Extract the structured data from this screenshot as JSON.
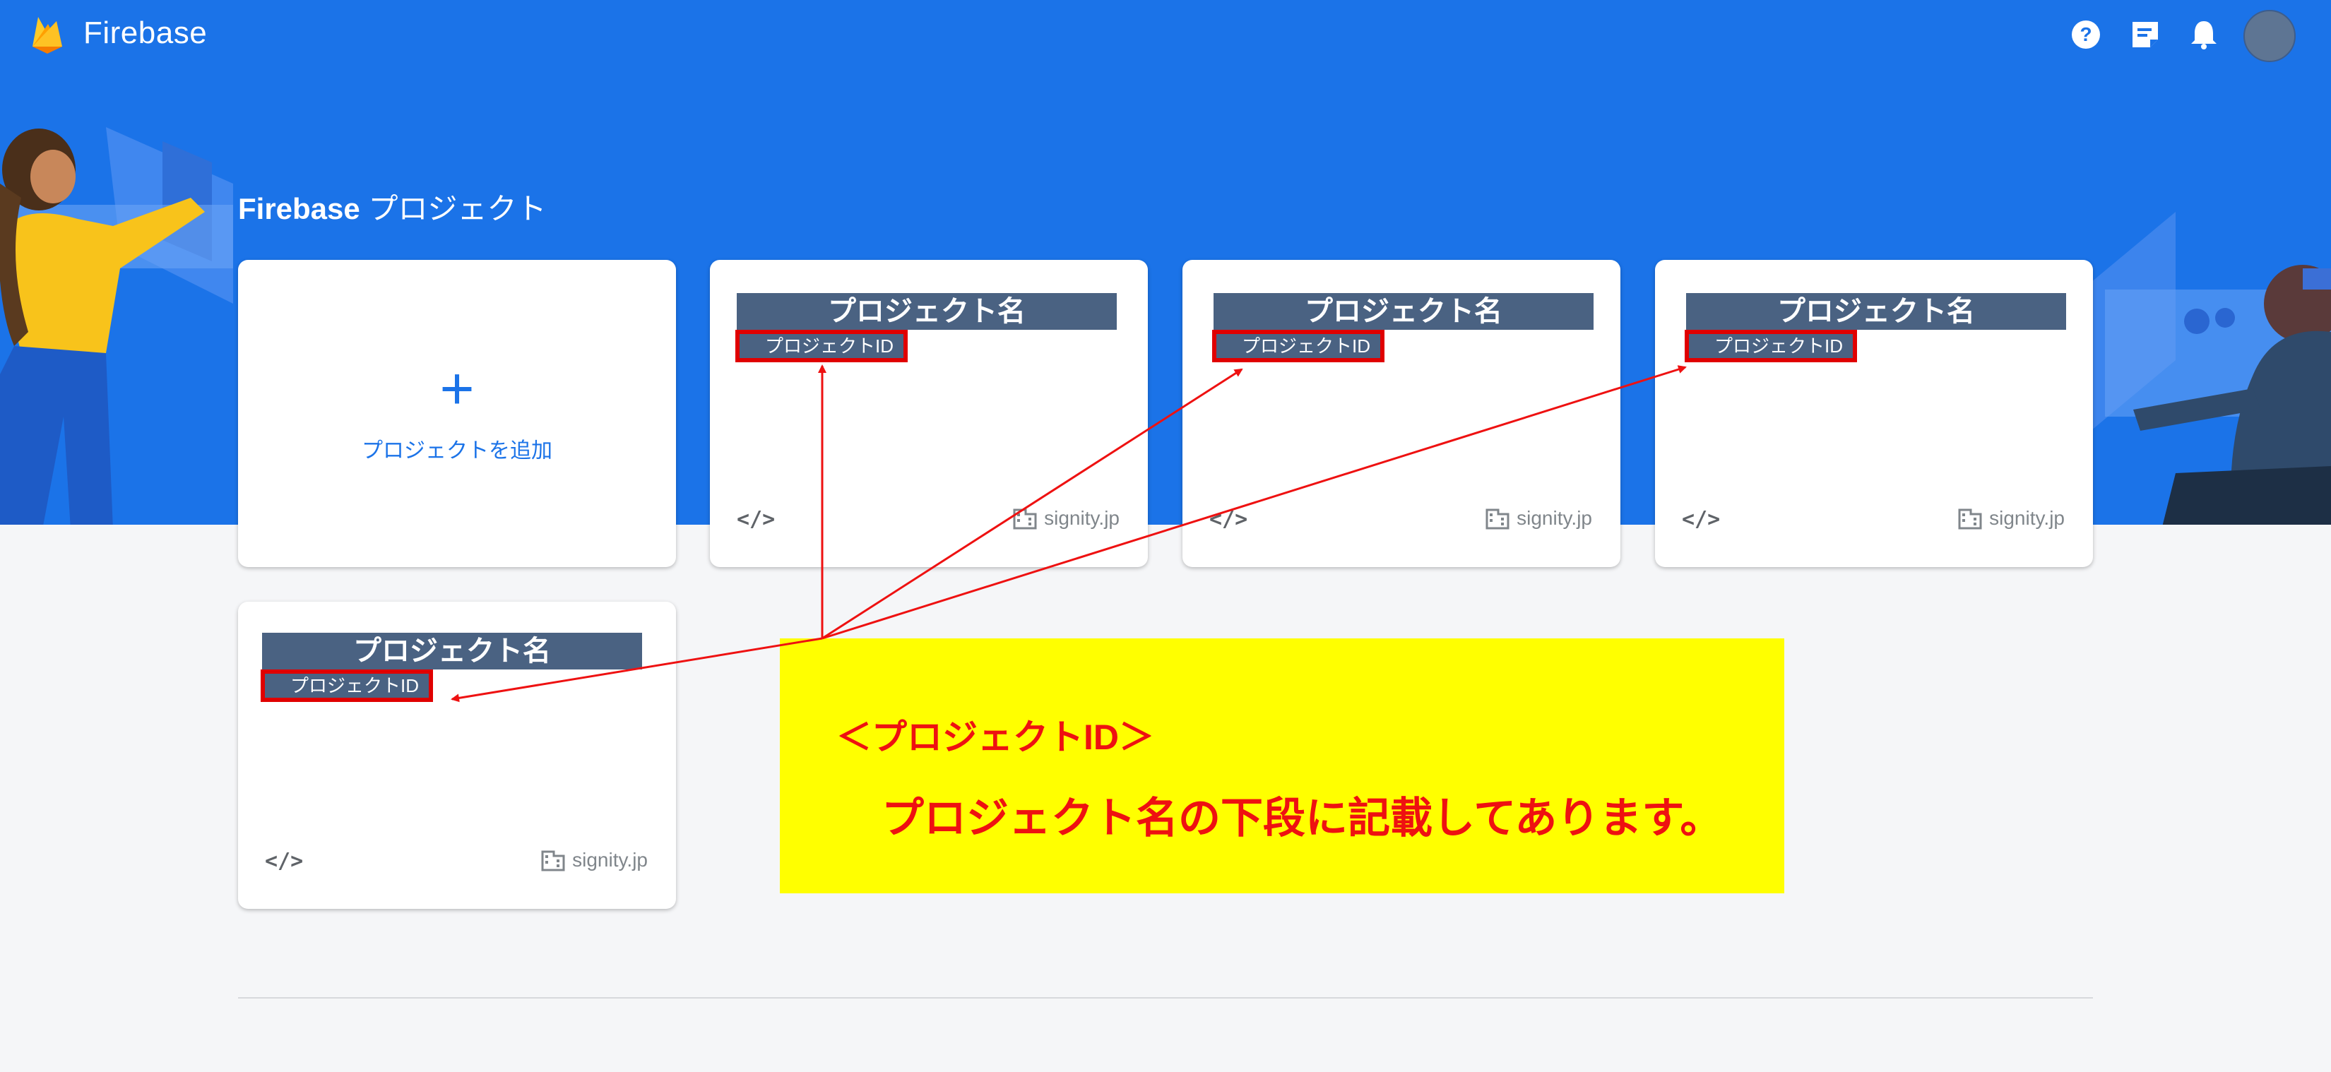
{
  "app": {
    "brand": "Firebase",
    "accent_color": "#1b73e8",
    "logo_icon": "firebase-flame-icon"
  },
  "header": {
    "icons": [
      "help-icon",
      "notes-icon",
      "notifications-bell-icon",
      "account-avatar"
    ]
  },
  "page": {
    "title_brand": "Firebase",
    "title_suffix": "プロジェクト"
  },
  "add_card": {
    "plus": "+",
    "label": "プロジェクトを追加"
  },
  "projects": [
    {
      "name": "プロジェクト名",
      "id": "プロジェクトID",
      "code_icon": "</>",
      "domain": "signity.jp"
    },
    {
      "name": "プロジェクト名",
      "id": "プロジェクトID",
      "code_icon": "</>",
      "domain": "signity.jp"
    },
    {
      "name": "プロジェクト名",
      "id": "プロジェクトID",
      "code_icon": "</>",
      "domain": "signity.jp"
    },
    {
      "name": "プロジェクト名",
      "id": "プロジェクトID",
      "code_icon": "</>",
      "domain": "signity.jp"
    }
  ],
  "annotation": {
    "title": "＜プロジェクトID＞",
    "body": "プロジェクト名の下段に記載してあります。",
    "box_color": "#ffff00",
    "text_color": "#ee1111"
  }
}
